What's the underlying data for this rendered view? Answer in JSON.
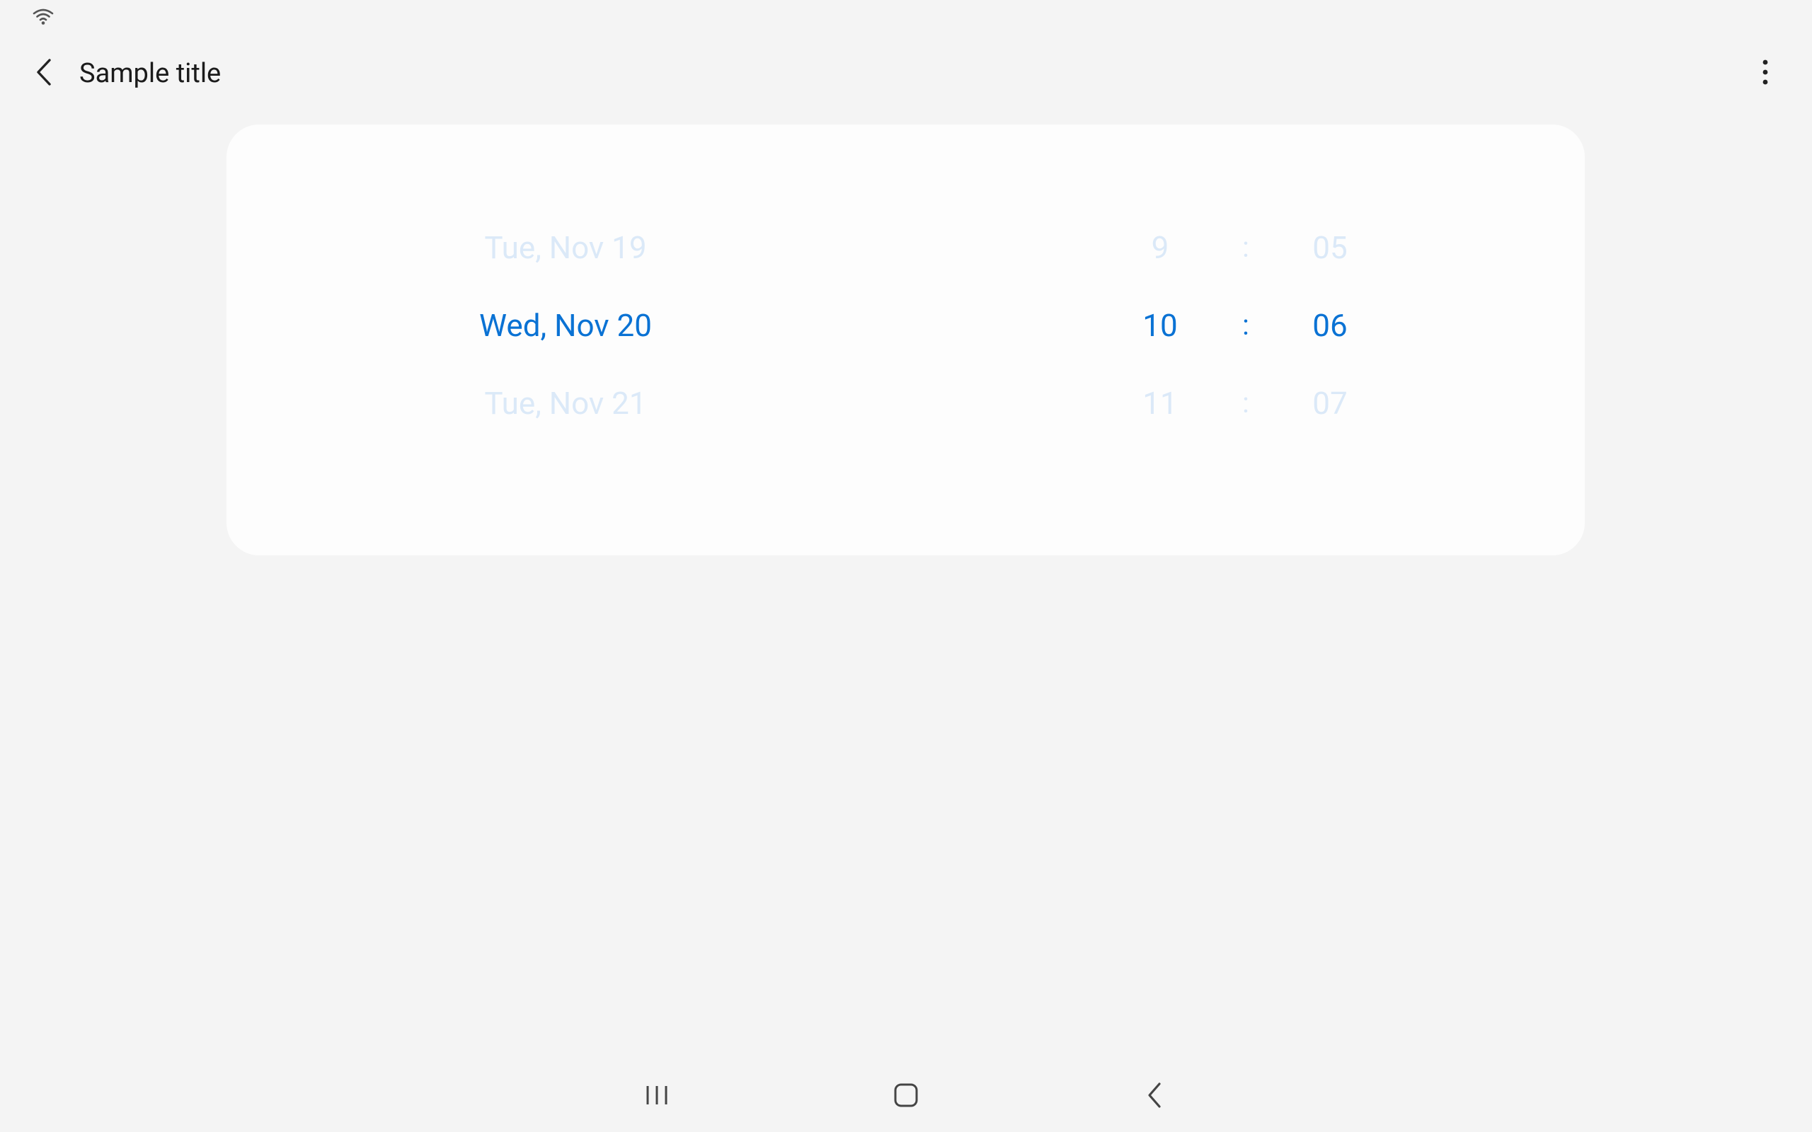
{
  "status_bar": {
    "wifi_icon": "wifi-icon"
  },
  "app_bar": {
    "title": "Sample title",
    "back_icon": "chevron-left-icon",
    "more_icon": "more-vertical-icon"
  },
  "picker": {
    "accent_color": "#0a72d4",
    "faded_color": "#dbe9f8",
    "date": {
      "prev": "Tue, Nov 19",
      "selected": "Wed, Nov 20",
      "next": "Tue, Nov 21"
    },
    "hour": {
      "prev": "9",
      "selected": "10",
      "next": "11"
    },
    "separator": ":",
    "minute": {
      "prev": "05",
      "selected": "06",
      "next": "07"
    }
  },
  "nav_bar": {
    "recents_icon": "recents-icon",
    "home_icon": "home-icon",
    "back_icon": "back-icon"
  }
}
